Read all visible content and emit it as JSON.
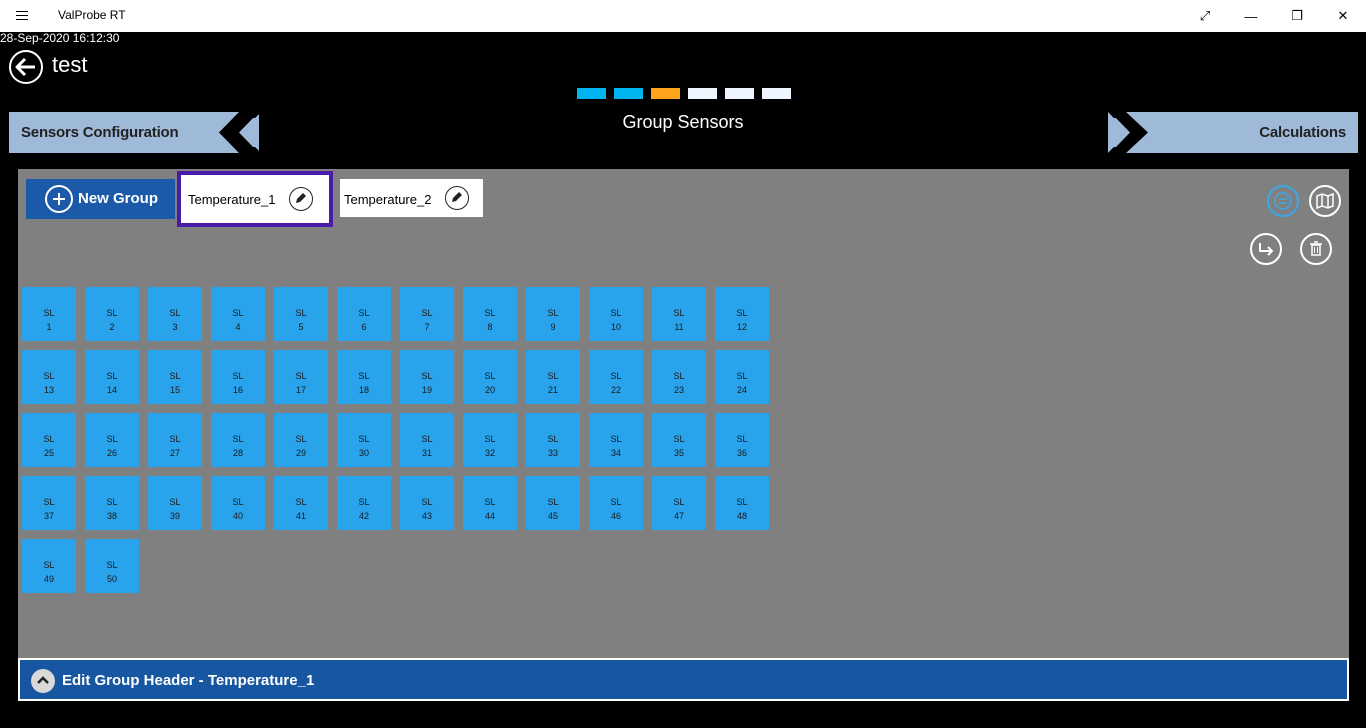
{
  "window": {
    "title": "ValProbe RT",
    "fullscreen_icon": "⤢",
    "minimize_icon": "—",
    "restore_icon": "❐",
    "close_icon": "✕"
  },
  "timestamp": "28-Sep-2020 16:12:30",
  "project_title": "test",
  "steps": [
    "#00b4f0",
    "#00b4f0",
    "#ffa41c",
    "#eef5ff",
    "#eef5ff",
    "#eef5ff"
  ],
  "nav": {
    "prev_label": "Sensors Configuration",
    "next_label": "Calculations",
    "page_heading": "Group Sensors"
  },
  "new_group_label": "New Group",
  "groups": [
    {
      "name": "Temperature_1",
      "selected": true
    },
    {
      "name": "Temperature_2",
      "selected": false
    }
  ],
  "sensor_prefix": "SL",
  "sensors": [
    "1",
    "2",
    "3",
    "4",
    "5",
    "6",
    "7",
    "8",
    "9",
    "10",
    "11",
    "12",
    "13",
    "14",
    "15",
    "16",
    "17",
    "18",
    "19",
    "20",
    "21",
    "22",
    "23",
    "24",
    "25",
    "26",
    "27",
    "28",
    "29",
    "30",
    "31",
    "32",
    "33",
    "34",
    "35",
    "36",
    "37",
    "38",
    "39",
    "40",
    "41",
    "42",
    "43",
    "44",
    "45",
    "46",
    "47",
    "48",
    "49",
    "50"
  ],
  "footer_label": "Edit Group Header - Temperature_1",
  "colors": {
    "accent": "#1b5aa8",
    "sensor": "#29a3ec",
    "selected_border": "#4a1aa8",
    "panel": "#808080"
  }
}
